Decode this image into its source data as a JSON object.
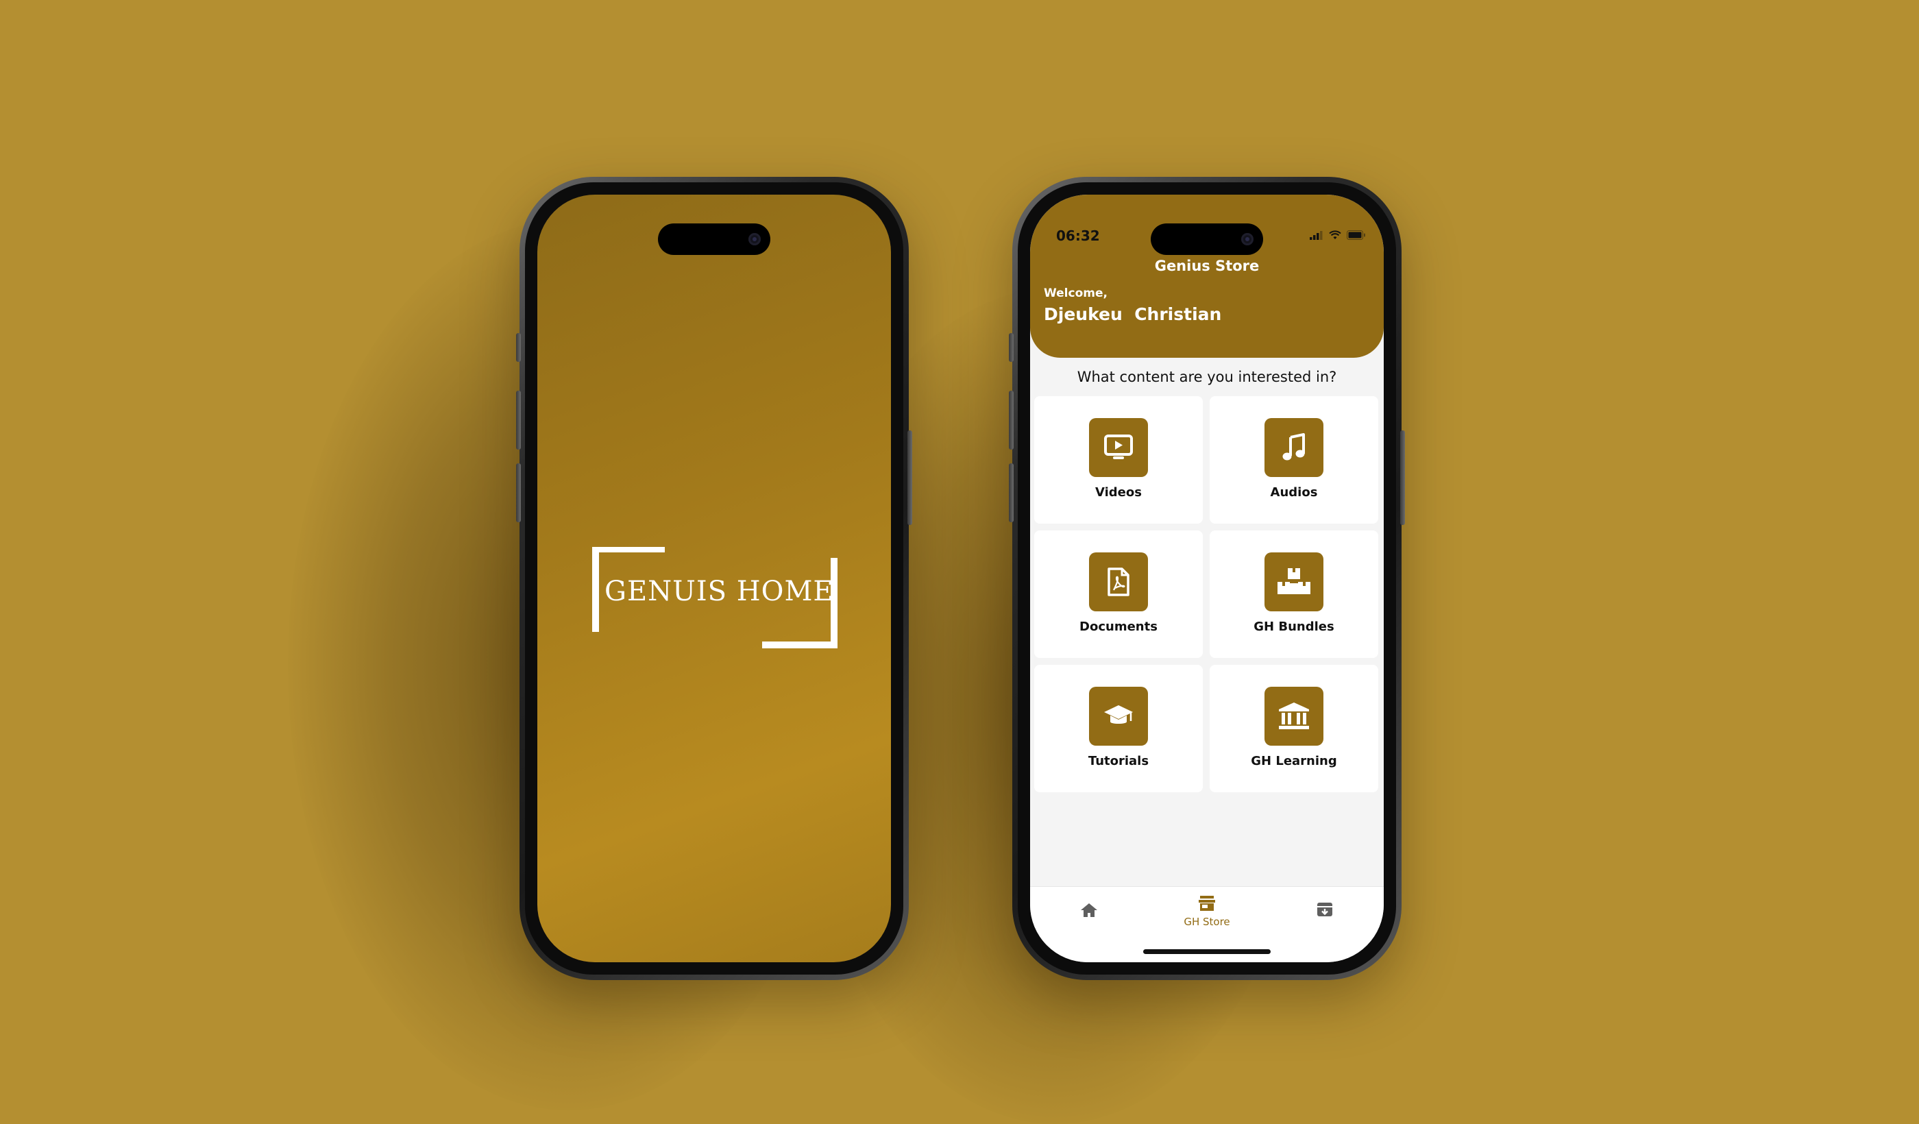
{
  "theme": {
    "background": "#b48f31",
    "brand": "#926c15",
    "brand_light": "#b88b20"
  },
  "splash": {
    "logo_text": "GENUIS HOME"
  },
  "store": {
    "status": {
      "time": "06:32",
      "icons": [
        "signal-icon",
        "wifi-icon",
        "battery-icon"
      ]
    },
    "header": {
      "title": "Genius Store",
      "welcome": "Welcome,",
      "user_name": "Djeukeu  Christian"
    },
    "question": "What content are you interested in?",
    "categories": [
      {
        "label": "Videos",
        "icon": "video-play-icon"
      },
      {
        "label": "Audios",
        "icon": "music-note-icon"
      },
      {
        "label": "Documents",
        "icon": "pdf-document-icon"
      },
      {
        "label": "GH Bundles",
        "icon": "bundles-boxes-icon"
      },
      {
        "label": "Tutorials",
        "icon": "graduation-cap-icon"
      },
      {
        "label": "GH Learning",
        "icon": "institution-icon"
      }
    ],
    "bottom_nav": [
      {
        "icon": "home-icon",
        "label": ""
      },
      {
        "icon": "store-icon",
        "label": "GH Store",
        "active": true
      },
      {
        "icon": "archive-icon",
        "label": ""
      }
    ]
  }
}
